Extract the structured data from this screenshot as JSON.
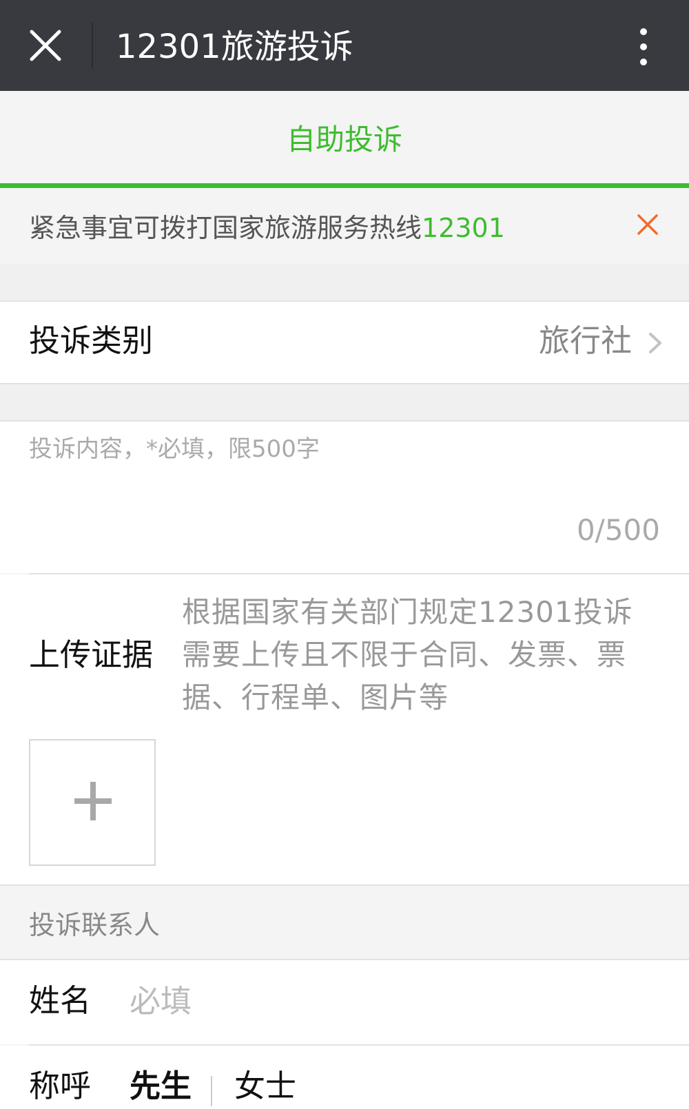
{
  "header": {
    "title": "12301旅游投诉",
    "close_icon": "close-icon",
    "more_icon": "more-vertical-icon"
  },
  "tabs": {
    "active_label": "自助投诉"
  },
  "notice": {
    "text": "紧急事宜可拨打国家旅游服务热线",
    "hotline": "12301",
    "close_icon": "close-icon"
  },
  "complaint_category": {
    "label": "投诉类别",
    "value": "旅行社"
  },
  "content": {
    "placeholder": "投诉内容，*必填，限500字",
    "value": "",
    "counter": "0/500"
  },
  "upload": {
    "label": "上传证据",
    "hint": "根据国家有关部门规定12301投诉需要上传且不限于合同、发票、票据、行程单、图片等",
    "add_icon": "plus-icon"
  },
  "contact": {
    "section_title": "投诉联系人",
    "name_label": "姓名",
    "name_placeholder": "必填",
    "salutation_label": "称呼",
    "options": [
      "先生",
      "女士"
    ],
    "selected": "先生"
  },
  "colors": {
    "accent": "#3dbc2f",
    "header_bg": "#393a3f",
    "close_accent": "#f06b2d"
  }
}
